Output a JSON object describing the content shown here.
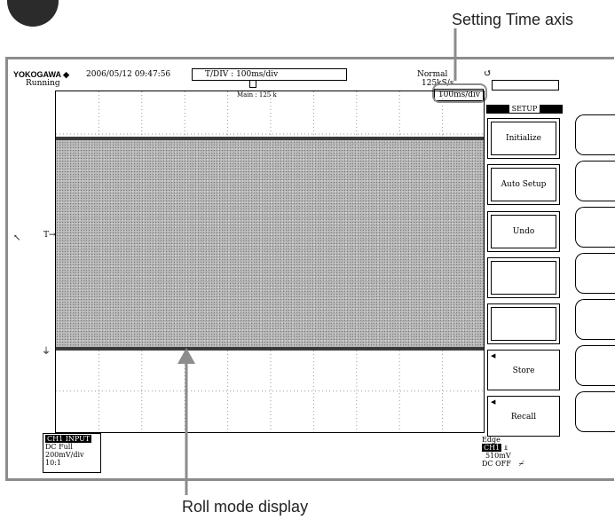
{
  "callouts": {
    "time_axis": "Setting Time axis",
    "roll_mode": "Roll mode display"
  },
  "header": {
    "brand": "YOKOGAWA ◆",
    "datetime": "2006/05/12 09:47:56",
    "status": "Running",
    "tdiv_label": "T/DIV",
    "tdiv_value": "100ms/div",
    "trigger_mode": "Normal",
    "sample_rate": "125kS/s",
    "main_memory": "Main : 125 k",
    "time_axis": "100ms/div"
  },
  "menu": {
    "title": "SETUP",
    "items": [
      {
        "label": "Initialize"
      },
      {
        "label": "Auto Setup"
      },
      {
        "label": "Undo"
      },
      {
        "label": ""
      },
      {
        "label": ""
      },
      {
        "label": "Store"
      },
      {
        "label": "Recall"
      }
    ]
  },
  "channel": {
    "title": "CH1  INPUT",
    "coupling": "DC Full",
    "scale": "200mV/div",
    "probe": "10:1"
  },
  "trigger": {
    "type": "Edge",
    "channel": "CH1",
    "level": "510mV",
    "hf": "DC OFF"
  },
  "colors": {
    "frame": "#8c8c8c",
    "signal": "#b9b9b9"
  }
}
